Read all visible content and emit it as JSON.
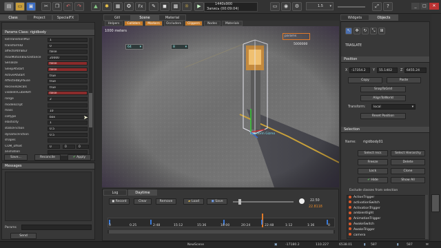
{
  "toolbar": {
    "resolution": "1440x900",
    "record_label": "Запись (00:09:04)",
    "quality_value": "1.5"
  },
  "left_tabs": [
    "Class",
    "Project",
    "SpecialFX"
  ],
  "class_panel": {
    "header": "Params Class: rigidbody",
    "properties": [
      {
        "k": "lodTransitionMul",
        "v": "1",
        "c": ""
      },
      {
        "k": "transformID",
        "v": "0",
        "c": ""
      },
      {
        "k": "affectsAtmBlur",
        "v": "false",
        "c": ""
      },
      {
        "k": "maxMotionBlurDistance",
        "v": "20000",
        "c": ""
      },
      {
        "k": "Serialize",
        "v": "false",
        "c": "red"
      },
      {
        "k": "SleepAtStart",
        "v": "false",
        "c": "red"
      },
      {
        "k": "ActiveAtStart",
        "v": "true",
        "c": ""
      },
      {
        "k": "AffectedByPause",
        "v": "true",
        "c": ""
      },
      {
        "k": "ReceiveDecals",
        "v": "true",
        "c": ""
      },
      {
        "k": "visibleInCubeRefl",
        "v": "false",
        "c": "red"
      },
      {
        "k": "range",
        "v": "2",
        "c": ""
      },
      {
        "k": "modelscript",
        "v": "",
        "c": ""
      },
      {
        "k": "mass",
        "v": "10",
        "c": ""
      },
      {
        "k": "coltype",
        "v": "box",
        "c": ""
      },
      {
        "k": "elasticity",
        "v": "1",
        "c": ""
      },
      {
        "k": "staticFriction",
        "v": "0.5",
        "c": ""
      },
      {
        "k": "dynamicFriction",
        "v": "0.5",
        "c": ""
      },
      {
        "k": "shapes",
        "v": "",
        "c": ""
      },
      {
        "k": "COM_offset",
        "v": "0",
        "c": ""
      },
      {
        "k": "animation",
        "v": "",
        "c": ""
      },
      {
        "k": "hideLayer",
        "v": "",
        "c": ""
      }
    ],
    "com_extra": [
      "0",
      "0"
    ],
    "save_label": "Save...",
    "reconcile_label": "Reconcile",
    "apply_label": "Apply"
  },
  "messages": {
    "header": "Messages",
    "params_label": "Params",
    "send_label": "Send"
  },
  "scene_tabs": [
    "Gill",
    "Scene",
    "Material"
  ],
  "scene_subtabs": [
    "Helpers",
    "Colliders",
    "Markers",
    "Occluders",
    "Clippers",
    "Nodes",
    "Materials"
  ],
  "scene": {
    "speed_label": "1000 meters",
    "dropdown1": "64",
    "dropdown2": "8",
    "orange_box": "params",
    "counter": "5000000",
    "gizmo_label": "Transform Gizmo"
  },
  "bottom_tabs": [
    "Log",
    "Daytime"
  ],
  "daytime": {
    "record_label": "Record",
    "clear_label": "Clear",
    "remove_label": "Remove",
    "load_label": "Load",
    "save_label": "Save",
    "time_value": "22.50",
    "time_highlight": "22.8118",
    "ticks": [
      "0",
      "0.25",
      "2:48",
      "15:12",
      "15:36",
      "18:00",
      "20:24",
      "22:48",
      "1:12",
      "1:36",
      "0"
    ]
  },
  "right_tabs": [
    "Widgets",
    "Objects"
  ],
  "objects": {
    "mode_label": "TRASLATE",
    "position_header": "Position",
    "x_label": "X",
    "x_value": "-17354.2",
    "y_label": "Y",
    "y_value": "55.1402",
    "z_label": "Z",
    "z_value": "6455.24",
    "copy_label": "Copy",
    "paste_label": "Paste",
    "snap_label": "SnapToGrid",
    "align_label": "AlignToWorld",
    "transform_label": "Transform:",
    "transform_value": "local",
    "reset_label": "Reset Position",
    "selection_header": "Selection",
    "name_label": "Name:",
    "name_value": "rigidbody01",
    "select_recs": "Select recs",
    "select_hierarchy": "Select Hierarchy",
    "freeze": "Freeze",
    "delete": "Delete",
    "lock": "Lock",
    "clone": "Clone",
    "hide": "Hide",
    "show_all": "Show All",
    "exclude_title": "Exclude classes from selection",
    "exclude_list": [
      "ActionTrigger",
      "activationSwitch",
      "ActivationTrigger",
      "ambientlight",
      "AnimationTrigger",
      "AwakeSwitch",
      "AwakeTrigger",
      "camera"
    ]
  },
  "statusbar": {
    "scene_name": "NewScene",
    "coord1": "-17180.2",
    "coord2": "110.227",
    "coord3": "6538.01",
    "fps": "587",
    "val2": "587"
  }
}
